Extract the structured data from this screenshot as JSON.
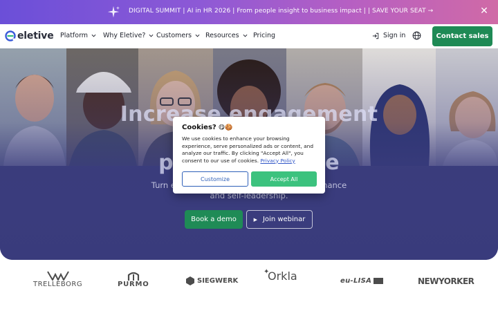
{
  "banner": {
    "text": "DIGITAL SUMMIT | AI in HR 2026 | From people insight to business impact | | SAVE YOUR SEAT →",
    "icon": "sparkle-icon",
    "close_icon": "close-icon"
  },
  "nav": {
    "brand": "eletive",
    "items": [
      {
        "label": "Platform",
        "dropdown": true
      },
      {
        "label": "Why Eletive?",
        "dropdown": true
      },
      {
        "label": "Customers",
        "dropdown": true
      },
      {
        "label": "Resources",
        "dropdown": true
      },
      {
        "label": "Pricing",
        "dropdown": false
      }
    ],
    "signin_label": "Sign in",
    "globe_icon": "globe-icon",
    "contact_label": "Contact sales"
  },
  "hero": {
    "headline_lines": [
      "Increase engagement",
      "& pe                    h AI-",
      "powere                    ligence"
    ],
    "subline_lines": [
      "Turn employee feedbac                                                 ture of high performance",
      "and self-leadership."
    ],
    "book_demo_label": "Book a demo",
    "webinar_label": "Join webinar"
  },
  "cookie": {
    "title": "Cookies?",
    "title_emoji": "😋🍪",
    "body": "We use cookies to enhance your browsing experience, serve personalized ads or content, and analyze our traffic. By clicking \"Accept All\", you consent to our use of cookies.",
    "policy_link": "Privacy Policy",
    "customize_label": "Customize",
    "accept_label": "Accept All"
  },
  "logos": [
    "TRELLEBORG",
    "PURMO",
    "SIEGWERK",
    "Orkla",
    "eu-LISA",
    "NEWYORKER"
  ],
  "colors": {
    "accent_green": "#1e8a55",
    "accept_green": "#3cc27e",
    "hero_blue": "#3a3c7d",
    "customize_blue": "#2d5fb8"
  }
}
